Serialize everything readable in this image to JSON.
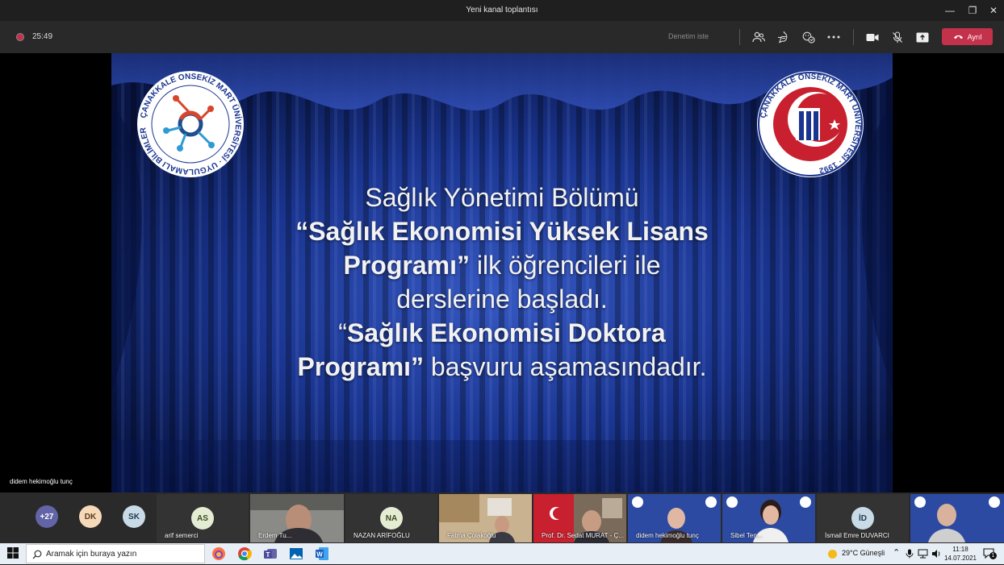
{
  "window": {
    "title": "Yeni kanal toplantısı"
  },
  "toolbar": {
    "timer": "25:49",
    "request_control": "Denetim iste",
    "leave_label": "Ayrıl"
  },
  "slide": {
    "lines": [
      {
        "text": "Sağlık Yönetimi Bölümü",
        "bold": false
      },
      {
        "text": "“Sağlık Ekonomisi Yüksek Lisans",
        "bold": true
      },
      {
        "bold_part": "Programı”",
        "rest": " ilk öğrencileri ile"
      },
      {
        "text": "derslerine başladı.",
        "bold": false
      },
      {
        "prefix": "“",
        "bold_part": "Sağlık Ekonomisi Doktora",
        "rest": ""
      },
      {
        "bold_part": "Programı”",
        "rest": " başvuru aşamasındadır."
      }
    ],
    "logo_left_ring_text": "ÇANAKKALE ONSEKİZ MART ÜNİVERSİTESİ · UYGULAMALI BİLİMLER FAKÜLTESİ 2020",
    "logo_right_ring_text": "ÇANAKKALE ONSEKİZ MART ÜNİVERSİTESİ · 1992"
  },
  "presenter_name": "didem hekimoğlu tunç",
  "participants": {
    "overflow_count": "+27",
    "avatars": [
      {
        "initials": "DK",
        "bg": "#f6d9b8",
        "fg": "#5a3a1a"
      },
      {
        "initials": "SK",
        "bg": "#c9dbe6",
        "fg": "#1f3a4d"
      }
    ],
    "tiles": [
      {
        "name": "arif semerci",
        "initials": "AS",
        "type": "avatar"
      },
      {
        "name": "Erdem Tu...",
        "type": "video"
      },
      {
        "name": "NAZAN ARİFOĞLU",
        "initials": "NA",
        "type": "avatar"
      },
      {
        "name": "Fatma Çolakoğlu",
        "type": "video"
      },
      {
        "name": "Prof. Dr. Sedat MURAT - Ç...",
        "type": "video"
      },
      {
        "name": "didem hekimoğlu tunç",
        "type": "video"
      },
      {
        "name": "Sibel Ten...",
        "type": "video"
      },
      {
        "name": "İsmail Emre DUVARCI",
        "initials": "İD",
        "type": "avatar"
      },
      {
        "name": "",
        "type": "video"
      }
    ]
  },
  "taskbar": {
    "search_placeholder": "Aramak için buraya yazın",
    "weather": "29°C Güneşli",
    "time": "11:18",
    "date": "14.07.2021",
    "notification_count": "1"
  },
  "colors": {
    "leave": "#c4314b",
    "slide_bg": "#0e1f5e",
    "accent": "#6264a7"
  }
}
